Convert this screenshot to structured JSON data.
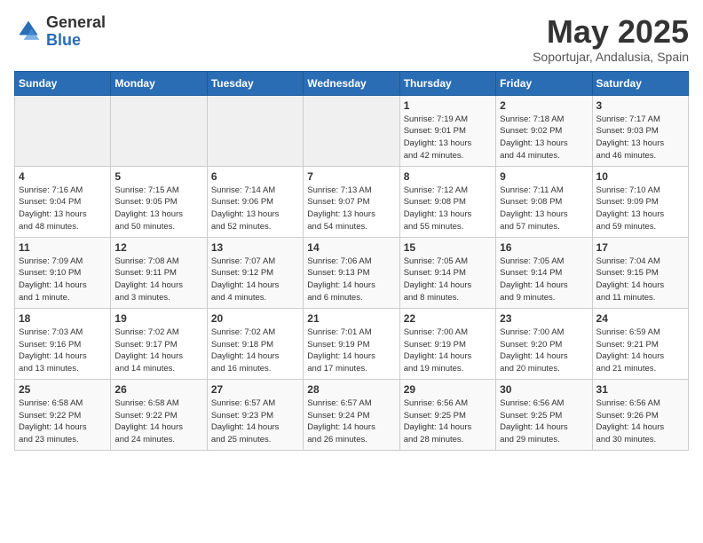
{
  "logo": {
    "general": "General",
    "blue": "Blue"
  },
  "title": "May 2025",
  "subtitle": "Soportujar, Andalusia, Spain",
  "days_header": [
    "Sunday",
    "Monday",
    "Tuesday",
    "Wednesday",
    "Thursday",
    "Friday",
    "Saturday"
  ],
  "weeks": [
    [
      {
        "num": "",
        "info": ""
      },
      {
        "num": "",
        "info": ""
      },
      {
        "num": "",
        "info": ""
      },
      {
        "num": "",
        "info": ""
      },
      {
        "num": "1",
        "info": "Sunrise: 7:19 AM\nSunset: 9:01 PM\nDaylight: 13 hours\nand 42 minutes."
      },
      {
        "num": "2",
        "info": "Sunrise: 7:18 AM\nSunset: 9:02 PM\nDaylight: 13 hours\nand 44 minutes."
      },
      {
        "num": "3",
        "info": "Sunrise: 7:17 AM\nSunset: 9:03 PM\nDaylight: 13 hours\nand 46 minutes."
      }
    ],
    [
      {
        "num": "4",
        "info": "Sunrise: 7:16 AM\nSunset: 9:04 PM\nDaylight: 13 hours\nand 48 minutes."
      },
      {
        "num": "5",
        "info": "Sunrise: 7:15 AM\nSunset: 9:05 PM\nDaylight: 13 hours\nand 50 minutes."
      },
      {
        "num": "6",
        "info": "Sunrise: 7:14 AM\nSunset: 9:06 PM\nDaylight: 13 hours\nand 52 minutes."
      },
      {
        "num": "7",
        "info": "Sunrise: 7:13 AM\nSunset: 9:07 PM\nDaylight: 13 hours\nand 54 minutes."
      },
      {
        "num": "8",
        "info": "Sunrise: 7:12 AM\nSunset: 9:08 PM\nDaylight: 13 hours\nand 55 minutes."
      },
      {
        "num": "9",
        "info": "Sunrise: 7:11 AM\nSunset: 9:08 PM\nDaylight: 13 hours\nand 57 minutes."
      },
      {
        "num": "10",
        "info": "Sunrise: 7:10 AM\nSunset: 9:09 PM\nDaylight: 13 hours\nand 59 minutes."
      }
    ],
    [
      {
        "num": "11",
        "info": "Sunrise: 7:09 AM\nSunset: 9:10 PM\nDaylight: 14 hours\nand 1 minute."
      },
      {
        "num": "12",
        "info": "Sunrise: 7:08 AM\nSunset: 9:11 PM\nDaylight: 14 hours\nand 3 minutes."
      },
      {
        "num": "13",
        "info": "Sunrise: 7:07 AM\nSunset: 9:12 PM\nDaylight: 14 hours\nand 4 minutes."
      },
      {
        "num": "14",
        "info": "Sunrise: 7:06 AM\nSunset: 9:13 PM\nDaylight: 14 hours\nand 6 minutes."
      },
      {
        "num": "15",
        "info": "Sunrise: 7:05 AM\nSunset: 9:14 PM\nDaylight: 14 hours\nand 8 minutes."
      },
      {
        "num": "16",
        "info": "Sunrise: 7:05 AM\nSunset: 9:14 PM\nDaylight: 14 hours\nand 9 minutes."
      },
      {
        "num": "17",
        "info": "Sunrise: 7:04 AM\nSunset: 9:15 PM\nDaylight: 14 hours\nand 11 minutes."
      }
    ],
    [
      {
        "num": "18",
        "info": "Sunrise: 7:03 AM\nSunset: 9:16 PM\nDaylight: 14 hours\nand 13 minutes."
      },
      {
        "num": "19",
        "info": "Sunrise: 7:02 AM\nSunset: 9:17 PM\nDaylight: 14 hours\nand 14 minutes."
      },
      {
        "num": "20",
        "info": "Sunrise: 7:02 AM\nSunset: 9:18 PM\nDaylight: 14 hours\nand 16 minutes."
      },
      {
        "num": "21",
        "info": "Sunrise: 7:01 AM\nSunset: 9:19 PM\nDaylight: 14 hours\nand 17 minutes."
      },
      {
        "num": "22",
        "info": "Sunrise: 7:00 AM\nSunset: 9:19 PM\nDaylight: 14 hours\nand 19 minutes."
      },
      {
        "num": "23",
        "info": "Sunrise: 7:00 AM\nSunset: 9:20 PM\nDaylight: 14 hours\nand 20 minutes."
      },
      {
        "num": "24",
        "info": "Sunrise: 6:59 AM\nSunset: 9:21 PM\nDaylight: 14 hours\nand 21 minutes."
      }
    ],
    [
      {
        "num": "25",
        "info": "Sunrise: 6:58 AM\nSunset: 9:22 PM\nDaylight: 14 hours\nand 23 minutes."
      },
      {
        "num": "26",
        "info": "Sunrise: 6:58 AM\nSunset: 9:22 PM\nDaylight: 14 hours\nand 24 minutes."
      },
      {
        "num": "27",
        "info": "Sunrise: 6:57 AM\nSunset: 9:23 PM\nDaylight: 14 hours\nand 25 minutes."
      },
      {
        "num": "28",
        "info": "Sunrise: 6:57 AM\nSunset: 9:24 PM\nDaylight: 14 hours\nand 26 minutes."
      },
      {
        "num": "29",
        "info": "Sunrise: 6:56 AM\nSunset: 9:25 PM\nDaylight: 14 hours\nand 28 minutes."
      },
      {
        "num": "30",
        "info": "Sunrise: 6:56 AM\nSunset: 9:25 PM\nDaylight: 14 hours\nand 29 minutes."
      },
      {
        "num": "31",
        "info": "Sunrise: 6:56 AM\nSunset: 9:26 PM\nDaylight: 14 hours\nand 30 minutes."
      }
    ]
  ]
}
